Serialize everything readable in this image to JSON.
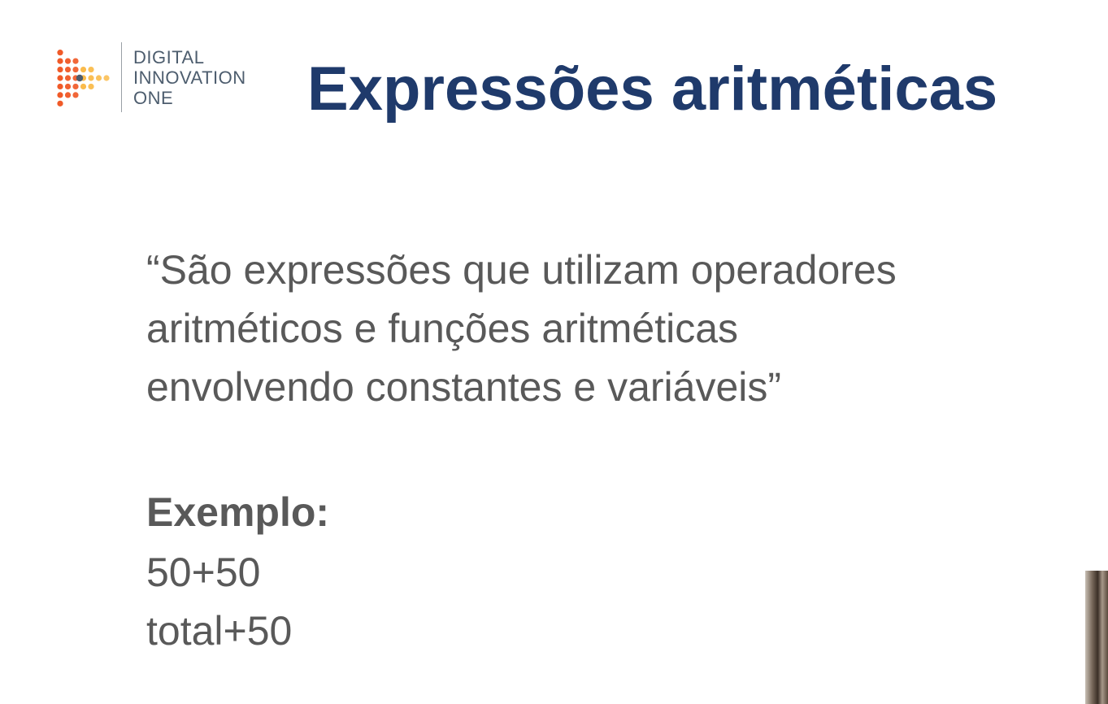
{
  "logo": {
    "line1": "DIGITAL",
    "line2": "INNOVATION",
    "line3": "ONE"
  },
  "title": "Expressões aritméticas",
  "quote": {
    "line1": "“São expressões que utilizam operadores",
    "line2": "aritméticos e funções aritméticas",
    "line3": "envolvendo constantes e variáveis”"
  },
  "example": {
    "heading": "Exemplo:",
    "items": [
      "50+50",
      "total+50"
    ]
  },
  "colors": {
    "title": "#1f3a6b",
    "body_text": "#595959",
    "logo_text": "#4d5d6e",
    "logo_orange": "#f05a28",
    "logo_yellow": "#f9b233"
  }
}
